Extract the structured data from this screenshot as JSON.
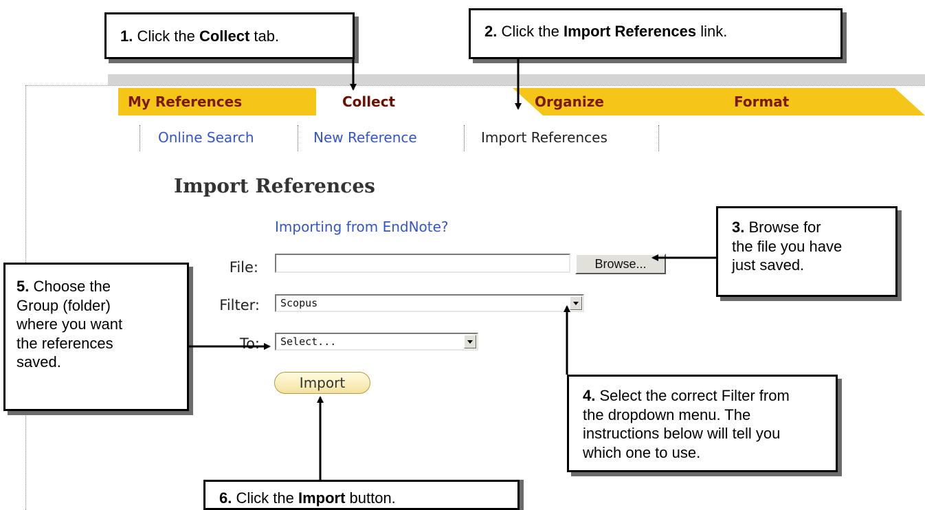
{
  "tabs": [
    {
      "label": "My References",
      "active": false
    },
    {
      "label": "Collect",
      "active": true
    },
    {
      "label": "Organize",
      "active": false
    },
    {
      "label": "Format",
      "active": false
    }
  ],
  "subnav": [
    {
      "label": "Online Search",
      "current": false
    },
    {
      "label": "New Reference",
      "current": false
    },
    {
      "label": "Import References",
      "current": true
    }
  ],
  "page_title": "Import References",
  "endnote_link": "Importing from EndNote?",
  "form": {
    "file_label": "File:",
    "file_value": "",
    "browse_label": "Browse...",
    "filter_label": "Filter:",
    "filter_value": "Scopus",
    "to_label": "To:",
    "to_value": "Select...",
    "import_label": "Import"
  },
  "callouts": {
    "c1": {
      "num": "1.",
      "pre": " Click the ",
      "bold": "Collect",
      "post": " tab."
    },
    "c2": {
      "num": "2.",
      "pre": " Click the ",
      "bold": "Import References",
      "post": " link."
    },
    "c3": {
      "num": "3.",
      "line1": " Browse for",
      "line2": "the file you have",
      "line3": "just saved."
    },
    "c4": {
      "num": "4.",
      "line1": " Select the correct Filter from",
      "line2": "the dropdown menu. The",
      "line3": "instructions below will tell you",
      "line4": "which one to use."
    },
    "c5": {
      "num": "5.",
      "line1": " Choose the",
      "line2": "Group (folder)",
      "line3": "where you want",
      "line4": "the references",
      "line5": "saved."
    },
    "c6": {
      "num": "6.",
      "pre": " Click the ",
      "bold": "Import",
      "post": " button."
    }
  },
  "colors": {
    "tab_yellow": "#f5c518",
    "link_blue": "#3355cc",
    "frame_gray": "#d4d4d4"
  }
}
